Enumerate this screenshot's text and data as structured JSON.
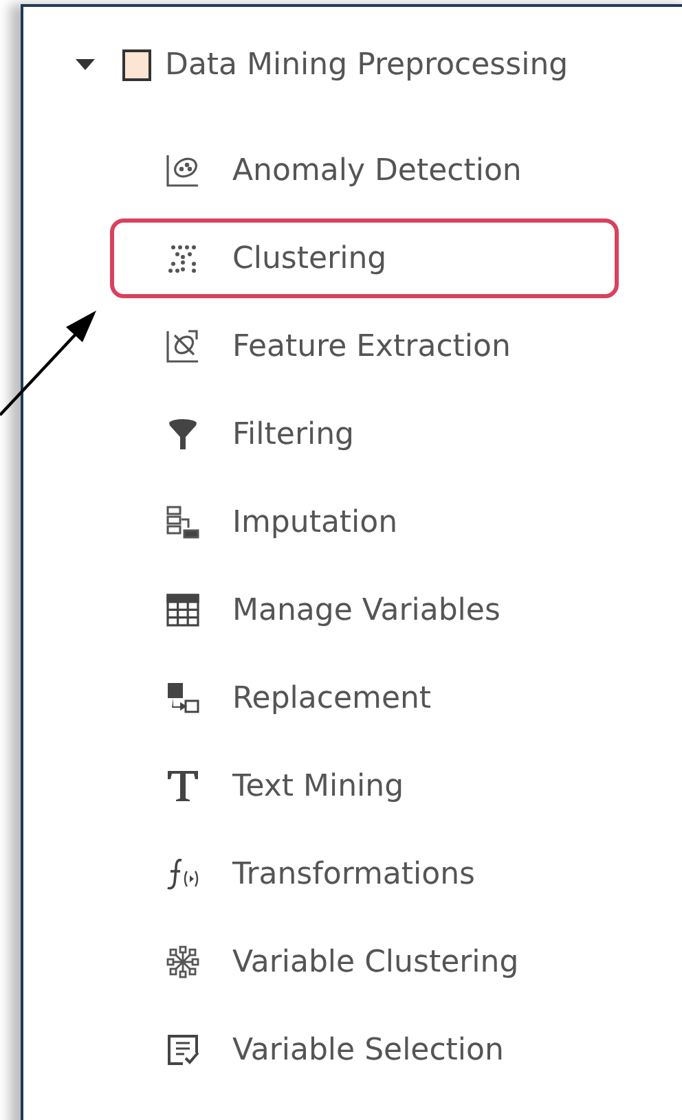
{
  "tree": {
    "label": "Data Mining Preprocessing",
    "expanded": true,
    "checked": false,
    "children": [
      {
        "label": "Anomaly Detection",
        "kind": "anomaly",
        "highlighted": false
      },
      {
        "label": "Clustering",
        "kind": "cluster",
        "highlighted": true
      },
      {
        "label": "Feature Extraction",
        "kind": "feature",
        "highlighted": false
      },
      {
        "label": "Filtering",
        "kind": "filter",
        "highlighted": false
      },
      {
        "label": "Imputation",
        "kind": "imputation",
        "highlighted": false
      },
      {
        "label": "Manage Variables",
        "kind": "grid",
        "highlighted": false
      },
      {
        "label": "Replacement",
        "kind": "replace",
        "highlighted": false
      },
      {
        "label": "Text Mining",
        "kind": "text",
        "highlighted": false
      },
      {
        "label": "Transformations",
        "kind": "function",
        "highlighted": false
      },
      {
        "label": "Variable Clustering",
        "kind": "network",
        "highlighted": false
      },
      {
        "label": "Variable Selection",
        "kind": "selection",
        "highlighted": false
      }
    ]
  }
}
